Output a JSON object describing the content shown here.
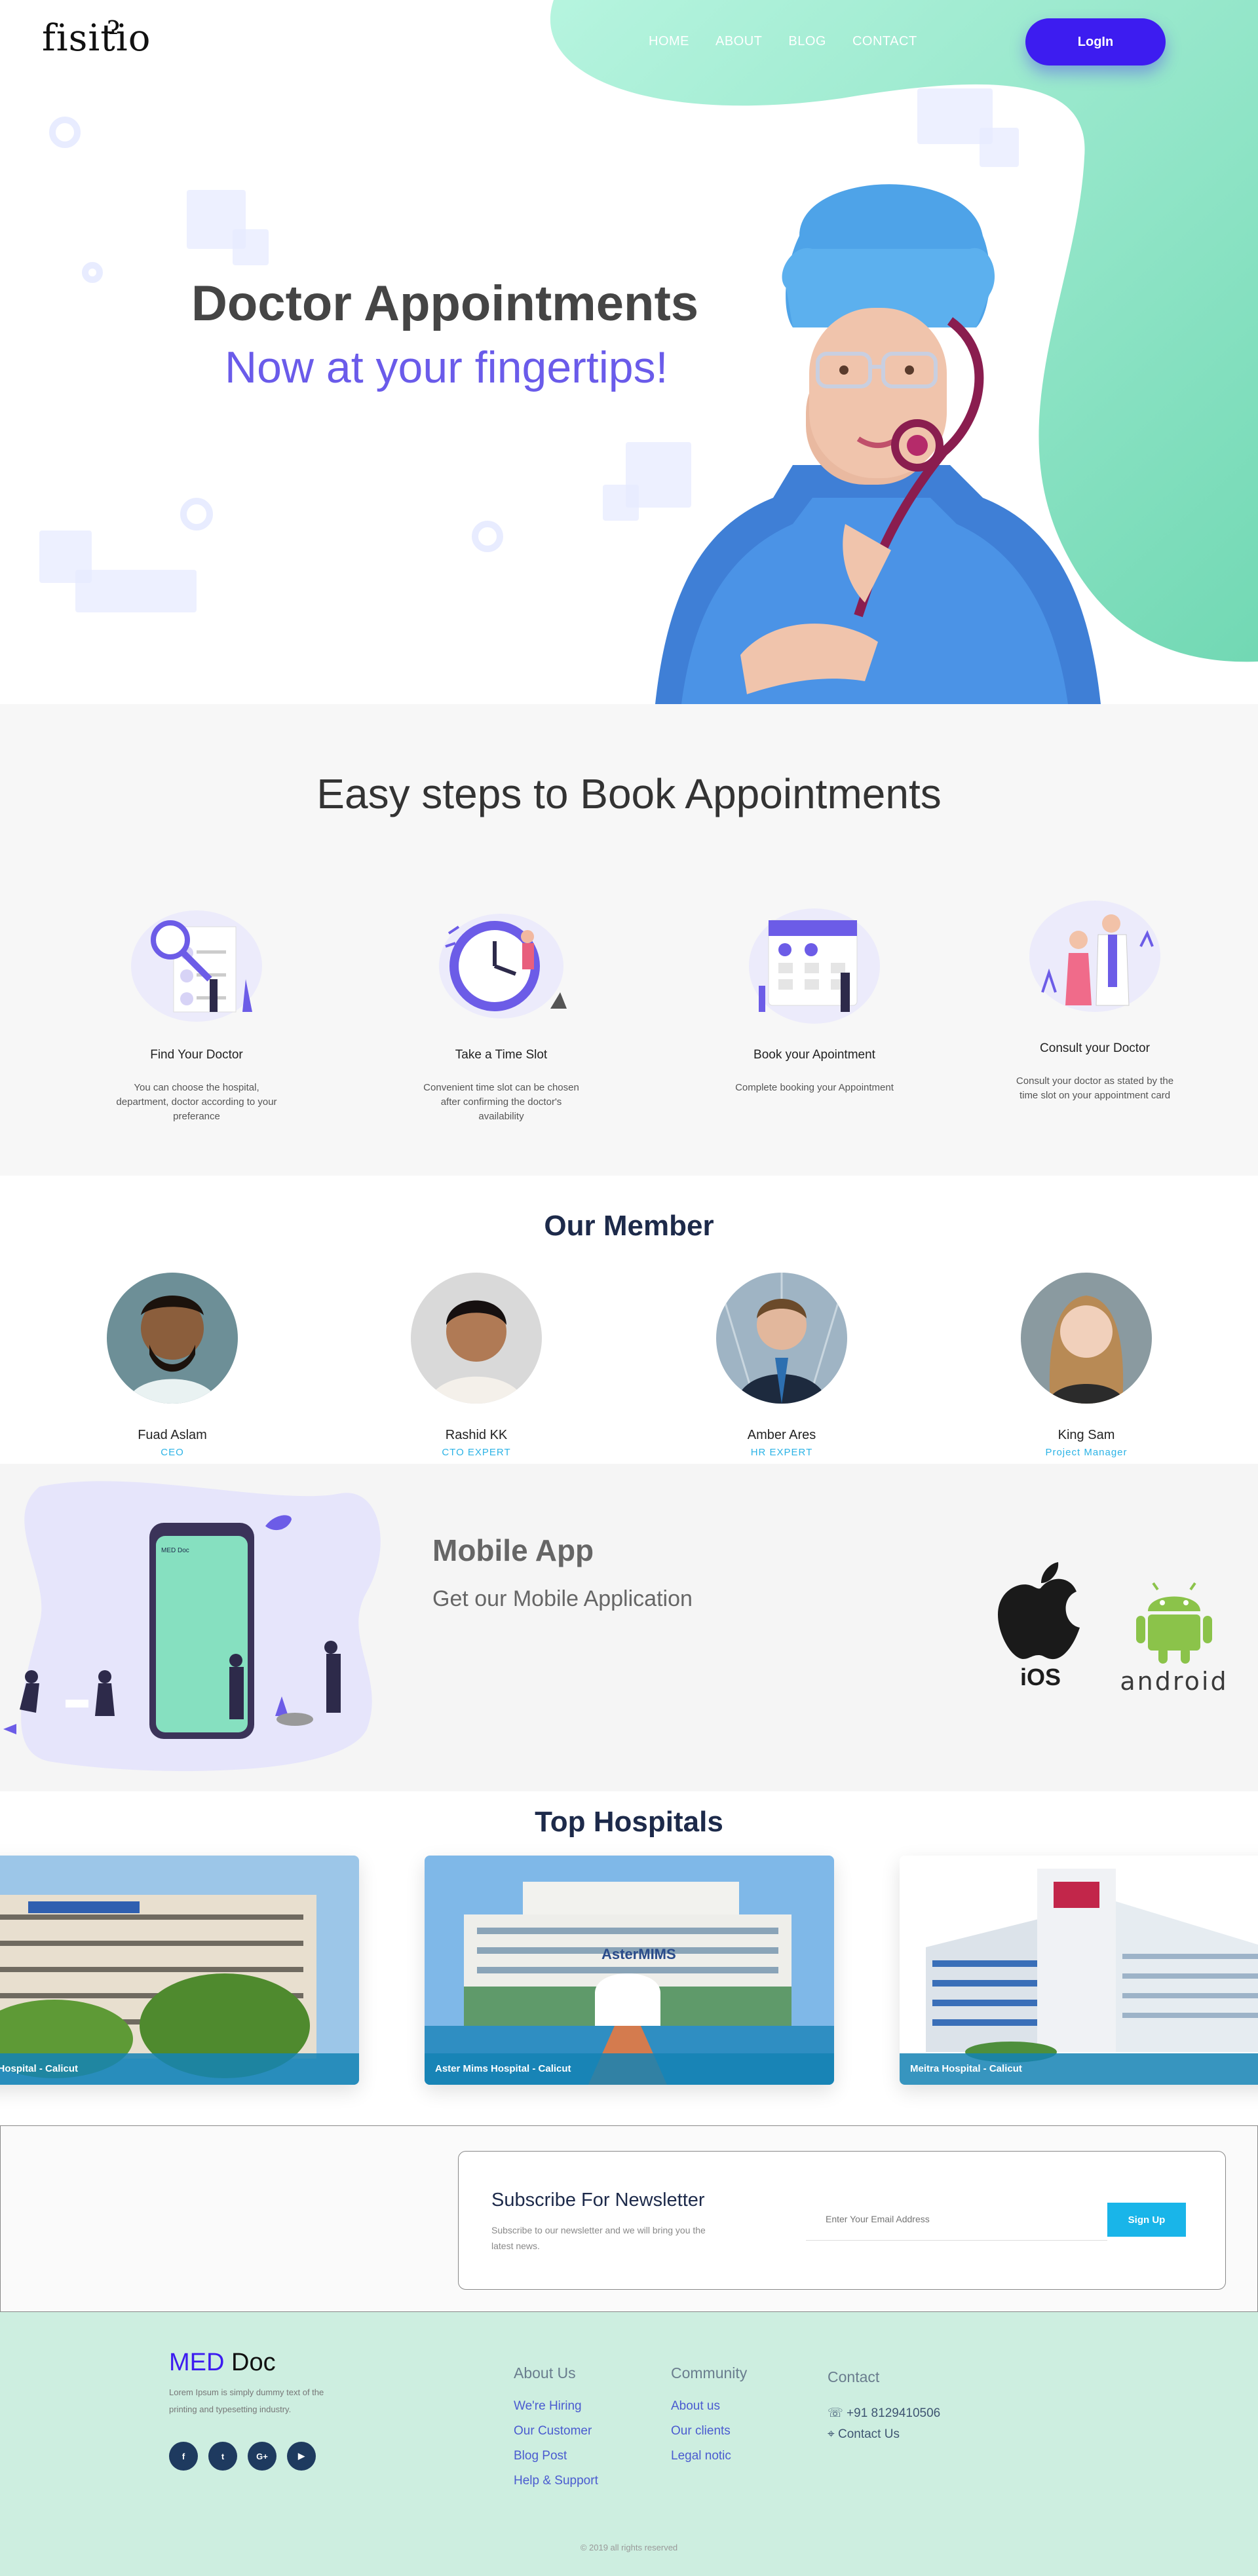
{
  "header": {
    "logo": "fisitio",
    "nav": [
      "HOME",
      "ABOUT",
      "BLOG",
      "CONTACT"
    ],
    "login_label": "LogIn"
  },
  "hero": {
    "title": "Doctor Appointments",
    "subtitle": "Now at your fingertips!"
  },
  "steps": {
    "heading": "Easy steps to Book Appointments",
    "items": [
      {
        "title": "Find Your Doctor",
        "desc": "You can choose the hospital, department, doctor according to your preferance"
      },
      {
        "title": "Take a Time Slot",
        "desc": "Convenient time slot can be chosen after confirming the doctor's availability"
      },
      {
        "title": "Book your Apointment",
        "desc": "Complete booking your Appointment"
      },
      {
        "title": "Consult your Doctor",
        "desc": "Consult your doctor as stated by the time slot on your appointment card"
      }
    ]
  },
  "members": {
    "heading": "Our Member",
    "items": [
      {
        "name": "Fuad Aslam",
        "role": "CEO"
      },
      {
        "name": "Rashid KK",
        "role": "CTO EXPERT"
      },
      {
        "name": "Amber Ares",
        "role": "HR EXPERT"
      },
      {
        "name": "King Sam",
        "role": "Project Manager"
      }
    ]
  },
  "mobile_app": {
    "title": "Mobile App",
    "subtitle": "Get our Mobile Application",
    "phone_label": "MED Doc",
    "ios_label": "iOS",
    "android_label": "android"
  },
  "hospitals": {
    "heading": "Top Hospitals",
    "items": [
      {
        "caption": "emorial Hospital - Calicut"
      },
      {
        "caption": "Aster Mims Hospital - Calicut"
      },
      {
        "caption": "Meitra Hospital - Calicut"
      }
    ]
  },
  "newsletter": {
    "title": "Subscribe For Newsletter",
    "desc": "Subscribe to our newsletter and we will bring you the latest news.",
    "placeholder": "Enter Your Email Address",
    "button": "Sign Up"
  },
  "footer": {
    "brand_accent": "MED",
    "brand_rest": " Doc",
    "desc": "Lorem Ipsum is simply dummy text of the printing and typesetting industry.",
    "socials": [
      "f",
      "t",
      "G+",
      "yt"
    ],
    "about": {
      "heading": "About Us",
      "links": [
        "We're Hiring",
        "Our Customer",
        "Blog Post",
        "Help & Support"
      ]
    },
    "community": {
      "heading": "Community",
      "links": [
        "About us",
        "Our clients",
        "Legal notic"
      ]
    },
    "contact": {
      "heading": "Contact",
      "phone": "+91 8129410506",
      "contact_us": "Contact Us"
    },
    "copyright": "© 2019 all rights reserved"
  }
}
